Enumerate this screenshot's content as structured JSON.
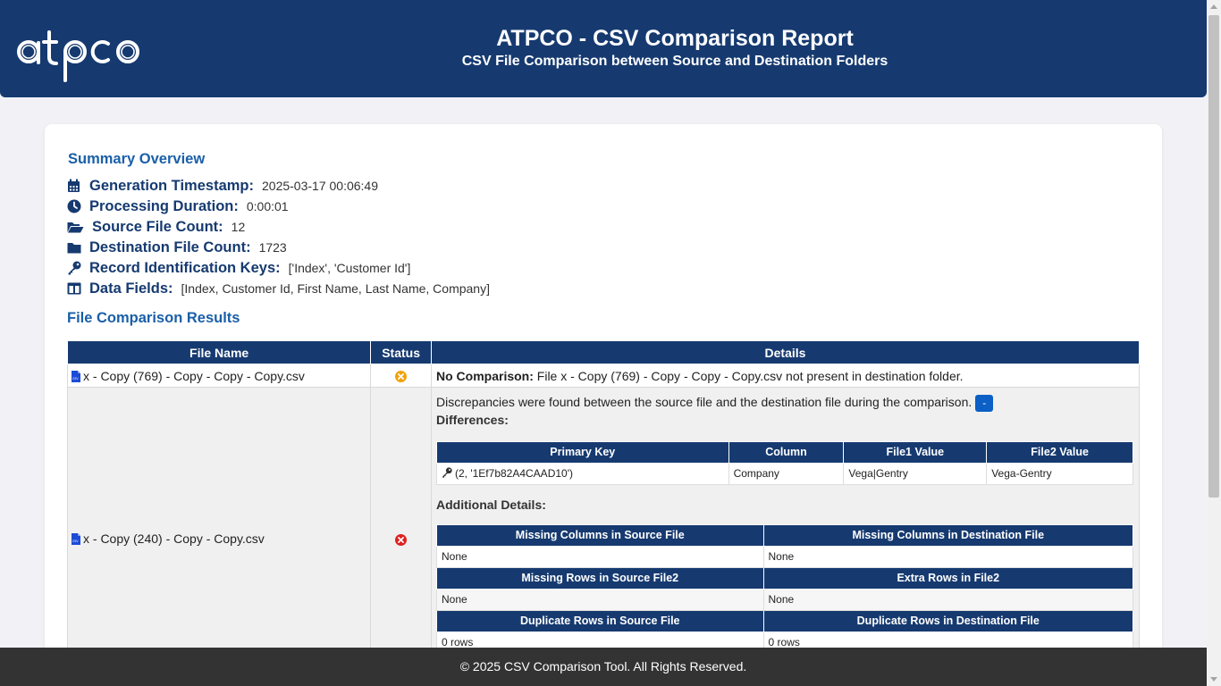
{
  "header": {
    "logo_text": "atpco",
    "title": "ATPCO - CSV Comparison Report",
    "subtitle": "CSV File Comparison between Source and Destination Folders"
  },
  "summary": {
    "heading": "Summary Overview",
    "items": [
      {
        "label": "Generation Timestamp:",
        "value": "2025-03-17 00:06:49",
        "icon": "calendar-icon"
      },
      {
        "label": "Processing Duration:",
        "value": "0:00:01",
        "icon": "clock-icon"
      },
      {
        "label": "Source File Count:",
        "value": "12",
        "icon": "folder-open-icon"
      },
      {
        "label": "Destination File Count:",
        "value": "1723",
        "icon": "folder-icon"
      },
      {
        "label": "Record Identification Keys:",
        "value": "['Index', 'Customer Id']",
        "icon": "key-icon"
      },
      {
        "label": "Data Fields:",
        "value": "[Index, Customer Id, First Name, Last Name, Company]",
        "icon": "columns-icon"
      }
    ]
  },
  "results": {
    "heading": "File Comparison Results",
    "columns": [
      "File Name",
      "Status",
      "Details"
    ],
    "rows": [
      {
        "file": "x - Copy (769) - Copy - Copy - Copy.csv",
        "status": "warning",
        "status_color": "#f0a30a",
        "detail_label": "No Comparison:",
        "detail_text": "File x - Copy (769) - Copy - Copy - Copy.csv not present in destination folder."
      },
      {
        "file": "x - Copy (240) - Copy - Copy.csv",
        "status": "error",
        "status_color": "#e02020",
        "discrepancy_text": "Discrepancies were found between the source file and the destination file during the comparison.",
        "toggle_label": "-",
        "differences_label": "Differences:",
        "diff_columns": [
          "Primary Key",
          "Column",
          "File1 Value",
          "File2 Value"
        ],
        "diff_rows": [
          {
            "key": "(2, '1Ef7b82A4CAAD10')",
            "column": "Company",
            "file1": "Vega|Gentry",
            "file2": "Vega-Gentry"
          }
        ],
        "additional_label": "Additional Details:",
        "additional": {
          "missing_cols_src_h": "Missing Columns in Source File",
          "missing_cols_dst_h": "Missing Columns in Destination File",
          "missing_cols_src": "None",
          "missing_cols_dst": "None",
          "missing_rows_src_h": "Missing Rows in Source File2",
          "extra_rows_h": "Extra Rows in File2",
          "missing_rows_src": "None",
          "extra_rows": "None",
          "dup_src_h": "Duplicate Rows in Source File",
          "dup_dst_h": "Duplicate Rows in Destination File",
          "dup_src": "0 rows",
          "dup_dst": "0 rows"
        }
      }
    ]
  },
  "footer": {
    "text": "© 2025 CSV Comparison Tool. All Rights Reserved."
  },
  "colors": {
    "brand_navy": "#163a70",
    "heading_blue": "#1a5fa8",
    "toggle_blue": "#0b5fc5",
    "footer_bg": "#333333"
  }
}
